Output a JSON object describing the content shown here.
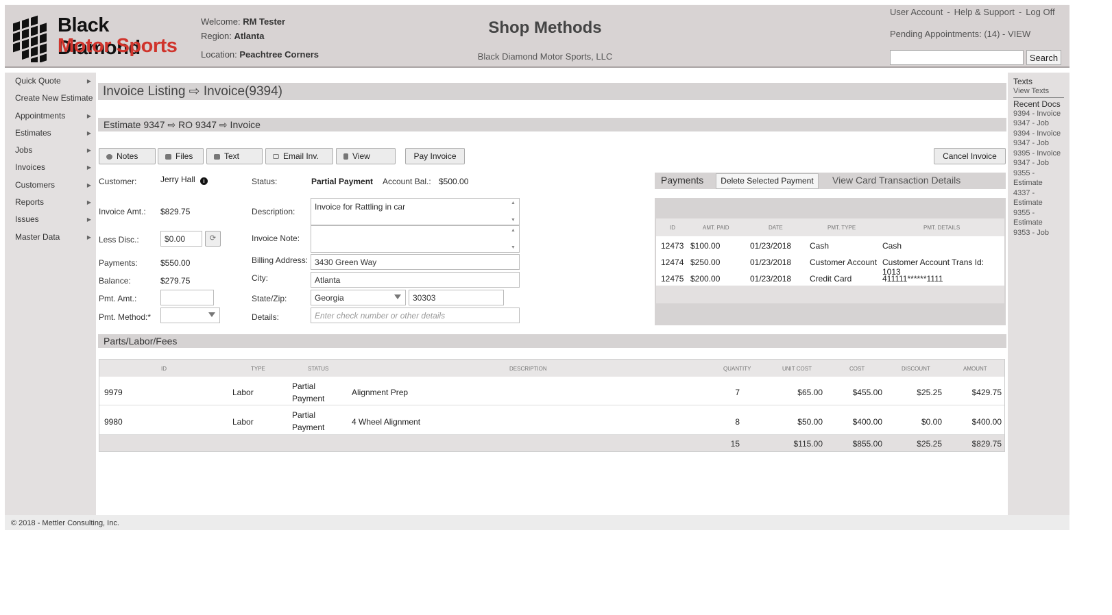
{
  "header": {
    "logo_line1": "Black Diamond",
    "logo_line2": "Motor Sports",
    "welcome_label": "Welcome:",
    "welcome_user": "RM Tester",
    "region_label": "Region:",
    "region_value": "Atlanta",
    "location_label": "Location:",
    "location_value": "Peachtree Corners",
    "app_title": "Shop Methods",
    "company": "Black Diamond Motor Sports, LLC",
    "links": [
      "User Account",
      "Help & Support",
      "Log Off"
    ],
    "pending": "Pending Appointments: (14) - VIEW",
    "search_value": "",
    "search_button": "Search"
  },
  "sidebar": {
    "items": [
      {
        "label": "Quick Quote",
        "arrow": true
      },
      {
        "label": "Create New Estimate",
        "arrow": false
      },
      {
        "label": "Appointments",
        "arrow": true
      },
      {
        "label": "Estimates",
        "arrow": true
      },
      {
        "label": "Jobs",
        "arrow": true
      },
      {
        "label": "Invoices",
        "arrow": true
      },
      {
        "label": "Customers",
        "arrow": true
      },
      {
        "label": "Reports",
        "arrow": true
      },
      {
        "label": "Issues",
        "arrow": true
      },
      {
        "label": "Master Data",
        "arrow": true
      }
    ]
  },
  "rightbar": {
    "texts_heading": "Texts",
    "view_texts": "View Texts",
    "recent_heading": "Recent Docs",
    "recent": [
      "9394 - Invoice",
      "9347 - Job",
      "9394 - Invoice",
      "9347 - Job",
      "9395 - Invoice",
      "9347 - Job",
      "9355 - Estimate",
      "4337 - Estimate",
      "9355 - Estimate",
      "9353 - Job"
    ]
  },
  "main": {
    "page_title": "Invoice Listing ⇨ Invoice(9394)",
    "sub_title": "Estimate 9347 ⇨ RO 9347 ⇨  Invoice",
    "buttons": {
      "notes": "Notes",
      "files": "Files",
      "text": "Text",
      "email": "Email Inv.",
      "view": "View",
      "pay": "Pay Invoice",
      "cancel": "Cancel Invoice"
    },
    "form": {
      "customer_label": "Customer:",
      "customer_value": "Jerry Hall",
      "invoice_amt_label": "Invoice Amt.:",
      "invoice_amt_value": "$829.75",
      "less_disc_label": "Less Disc.:",
      "less_disc_value": "$0.00",
      "payments_label": "Payments:",
      "payments_value": "$550.00",
      "balance_label": "Balance:",
      "balance_value": "$279.75",
      "pmt_amt_label": "Pmt. Amt.:",
      "pmt_amt_value": "",
      "pmt_method_label": "Pmt. Method:*",
      "pmt_method_value": "",
      "status_label": "Status:",
      "status_value": "Partial Payment",
      "account_bal_label": "Account Bal.:",
      "account_bal_value": "$500.00",
      "description_label": "Description:",
      "description_value": "Invoice for Rattling in car",
      "invoice_note_label": "Invoice Note:",
      "invoice_note_value": "",
      "billing_label": "Billing Address:",
      "billing_value": "3430 Green Way",
      "city_label": "City:",
      "city_value": "Atlanta",
      "state_zip_label": "State/Zip:",
      "state_value": "Georgia",
      "zip_value": "30303",
      "details_label": "Details:",
      "details_placeholder": "Enter check number or other details"
    },
    "payments": {
      "title": "Payments",
      "delete_button": "Delete Selected Payment",
      "view_card": "View Card Transaction Details",
      "columns": [
        "ID",
        "AMT. PAID",
        "DATE",
        "PMT. TYPE",
        "PMT. DETAILS"
      ],
      "rows": [
        [
          "12473",
          "$100.00",
          "01/23/2018",
          "Cash",
          "Cash"
        ],
        [
          "12474",
          "$250.00",
          "01/23/2018",
          "Customer Account",
          "Customer Account Trans Id: 1013"
        ],
        [
          "12475",
          "$200.00",
          "01/23/2018",
          "Credit Card",
          "411111******1111"
        ]
      ]
    },
    "parts": {
      "title": "Parts/Labor/Fees",
      "columns": [
        "ID",
        "TYPE",
        "STATUS",
        "DESCRIPTION",
        "QUANTITY",
        "UNIT COST",
        "COST",
        "DISCOUNT",
        "AMOUNT"
      ],
      "rows": [
        {
          "id": "9979",
          "type": "Labor",
          "status1": "Partial",
          "status2": "Payment",
          "description": "Alignment Prep",
          "quantity": "7",
          "unit_cost": "$65.00",
          "cost": "$455.00",
          "discount": "$25.25",
          "amount": "$429.75"
        },
        {
          "id": "9980",
          "type": "Labor",
          "status1": "Partial",
          "status2": "Payment",
          "description": "4 Wheel Alignment",
          "quantity": "8",
          "unit_cost": "$50.00",
          "cost": "$400.00",
          "discount": "$0.00",
          "amount": "$400.00"
        }
      ],
      "totals": {
        "quantity": "15",
        "unit_cost": "$115.00",
        "cost": "$855.00",
        "discount": "$25.25",
        "amount": "$829.75"
      }
    }
  },
  "footer": {
    "copyright": "© 2018 - Mettler Consulting, Inc."
  },
  "colors": {
    "brand_red": "#d0342c",
    "header_bg": "#d8d3d3",
    "panel_bg": "#d6d3d3"
  }
}
